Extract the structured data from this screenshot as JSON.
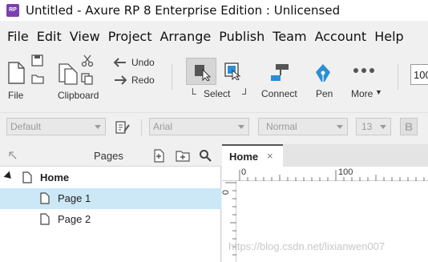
{
  "window": {
    "app_icon_text": "RP",
    "title": "Untitled - Axure RP 8 Enterprise Edition : Unlicensed"
  },
  "menu": [
    {
      "label": "File"
    },
    {
      "label": "Edit"
    },
    {
      "label": "View"
    },
    {
      "label": "Project"
    },
    {
      "label": "Arrange"
    },
    {
      "label": "Publish"
    },
    {
      "label": "Team"
    },
    {
      "label": "Account"
    },
    {
      "label": "Help"
    }
  ],
  "toolbar": {
    "file_label": "File",
    "clipboard_label": "Clipboard",
    "undo_label": "Undo",
    "redo_label": "Redo",
    "select_label": "Select",
    "connect_label": "Connect",
    "pen_label": "Pen",
    "more_label": "More",
    "zoom_value": "100"
  },
  "format_bar": {
    "style_value": "Default",
    "font_value": "Arial",
    "weight_value": "Normal",
    "size_value": "13",
    "bold_label": "B"
  },
  "pages_panel": {
    "title": "Pages",
    "tree": [
      {
        "label": "Home",
        "level": 0,
        "expanded": true,
        "selected": false
      },
      {
        "label": "Page 1",
        "level": 1,
        "selected": true
      },
      {
        "label": "Page 2",
        "level": 1,
        "selected": false
      }
    ]
  },
  "canvas": {
    "tab_label": "Home",
    "tab_close": "×",
    "ruler_top_labels": [
      "0",
      "100"
    ],
    "ruler_left_label": "0"
  },
  "watermark": "https://blog.csdn.net/lixianwen007",
  "colors": {
    "selected_row": "#cce8f6",
    "accent_blue": "#2a8fd4",
    "app_icon": "#7b3fb0"
  }
}
